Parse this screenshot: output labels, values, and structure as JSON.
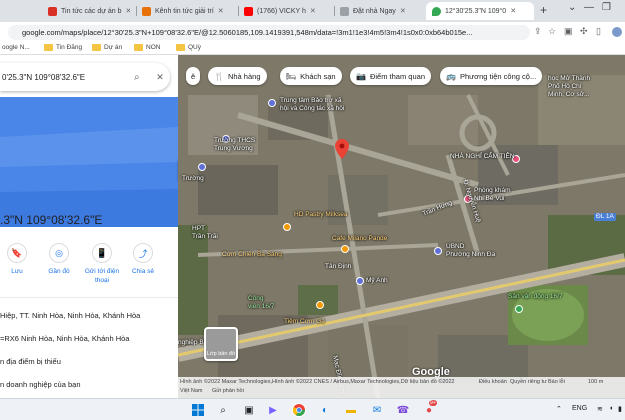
{
  "browser": {
    "tabs": [
      {
        "title": "Tin tức các dự án b",
        "color": "#d93025"
      },
      {
        "title": "Kênh tin tức giải trí",
        "color": "#e8710a"
      },
      {
        "title": "(1766) VICKY h",
        "color": "#ff0000"
      },
      {
        "title": "Đặt nhà Ngay",
        "color": "#9aa0a6"
      },
      {
        "title": "12°30'25.3\"N 109°0",
        "color": "#34a853"
      }
    ],
    "new_tab_symbol": "+",
    "url": "google.com/maps/place/12°30'25.3\"N+109°08'32.6\"E/@12.5060185,109.1419391,548m/data=!3m1!1e3!4m5!3m4!1s0x0:0xb64b015e...",
    "bookmarks": [
      {
        "label": "oogle N..."
      },
      {
        "label": "Tin Đăng"
      },
      {
        "label": "Dự án"
      },
      {
        "label": "NON"
      },
      {
        "label": "QUỳ"
      }
    ]
  },
  "panel": {
    "search_text": "0'25.3\"N 109°08'32.6\"E",
    "coord_title": ".3\"N 109°08'32.6\"E",
    "actions": [
      {
        "label": "Lưu",
        "icon": "bookmark-icon",
        "glyph": "🔖"
      },
      {
        "label": "Gần đó",
        "icon": "nearby-icon",
        "glyph": "◎"
      },
      {
        "label": "Gửi tới điện thoại",
        "icon": "send-to-phone-icon",
        "glyph": "📱"
      },
      {
        "label": "Chia sẻ",
        "icon": "share-icon",
        "glyph": "⤴"
      }
    ],
    "address": "Hiệp, TT. Ninh Hòa, Ninh Hòa, Khánh Hòa",
    "plus_code": "=RX6 Ninh Hòa, Ninh Hòa, Khánh Hòa",
    "add_place": "n địa điểm bị thiếu",
    "add_business": "n doanh nghiệp của bạn"
  },
  "map": {
    "chips": [
      {
        "label": "Nhà hàng",
        "icon": "🍴"
      },
      {
        "label": "Khách sạn",
        "icon": "🛏"
      },
      {
        "label": "Điểm tham quan",
        "icon": "📷"
      },
      {
        "label": "Phương tiện công cộ...",
        "icon": "🚌"
      }
    ],
    "labels": {
      "l1": "Trung tâm Bảo trợ xã",
      "l2": "hội và Công tác xã hội",
      "l3": "Trường THCS",
      "l4": "Trung Vương",
      "l5": "Trường",
      "l6": "HPT",
      "l7": "Trần Trãi",
      "l8": "HD Pastry Milksea",
      "l9": "Cafe Milano Pande",
      "l10": "Cơm Chiên Ba Sáng",
      "l11": "Tân Định",
      "l12": "Mỹ Anh",
      "l13": "Công",
      "l14": "viên 16/7",
      "l15": "Tiệm Cơm Gà",
      "l16": "Mạc Đĩnh Chi",
      "l17": "Trần Hưng",
      "l18": "Đ. Nguyễn Huệ",
      "l19": "Phòng khám",
      "l20": "Nhi Bé Vui",
      "l21": "UBND",
      "l22": "Phường Ninh Đa",
      "l23": "Sân vận động 16/7",
      "l24": "học Mở Thành",
      "l25": "Phố Hồ Chí",
      "l26": "Minh, Cơ sở...",
      "l27": "NHÀ NGHỈ CẨM TIÊN",
      "l28": "nghiệp Bank ATM",
      "l29": "ĐL 1A"
    },
    "layers_label": "Lớp bản đồ",
    "google": "Google",
    "footer": {
      "f1": "Hình ảnh ©2022 Maxar Technologies,Hình ảnh ©2022 CNES / Airbus,Maxar Technologies,Dữ liệu bản đồ ©2022",
      "f2": "Điều khoản",
      "f3": "Quyền riêng tư",
      "f4": "Báo lỗi",
      "f5": "100 m",
      "f6": "Việt Nam",
      "f7": "Gửi phản hồi"
    }
  },
  "taskbar": {
    "badge": "9+",
    "lang": "ENG"
  }
}
